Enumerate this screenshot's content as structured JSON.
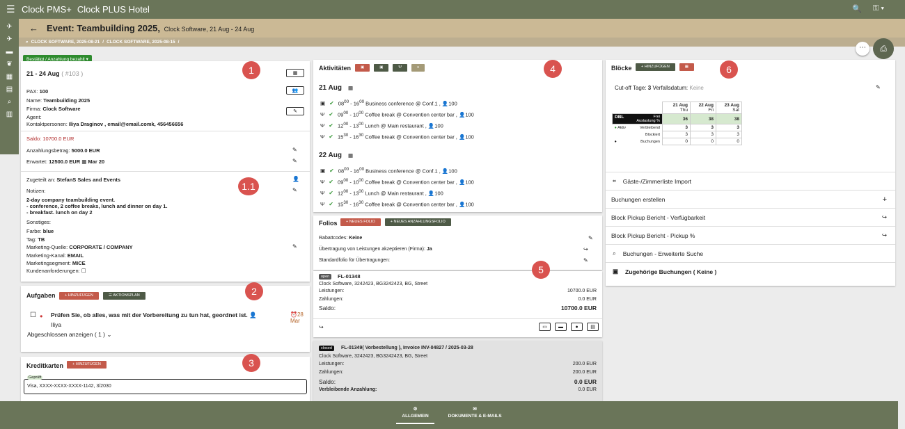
{
  "top": {
    "app": "Clock PMS+",
    "hotel": "Clock PLUS Hotel"
  },
  "header": {
    "title": "Event: Teambuilding 2025,",
    "subtitle": "Clock Software, 21 Aug - 24 Aug",
    "breadcrumb1": "CLOCK SOFTWARE, 2025-08-21",
    "breadcrumb2": "CLOCK SOFTWARE, 2025-08-15"
  },
  "status": "Bestätigt / Anzahlung bezahlt",
  "badges": [
    "1",
    "1.1",
    "2",
    "3",
    "4",
    "5",
    "6"
  ],
  "event": {
    "dates": "21 - 24 Aug",
    "id": "( #103 )",
    "pax_label": "PAX:",
    "pax": "100",
    "name_label": "Name:",
    "name": "Teambuilding 2025",
    "firm_label": "Firma:",
    "firm": "Clock Software",
    "agent_label": "Agent:",
    "contact_label": "Kontaktpersonen:",
    "contact": "Iliya Draginov , email@email.comk, 456456656",
    "saldo": "Saldo: 10700.0 EUR",
    "dep_label": "Anzahlungsbetrag:",
    "dep": "5000.0 EUR",
    "exp_label": "Erwartet:",
    "exp": "12500.0 EUR",
    "exp_date": "Mar 20",
    "assigned_label": "Zugeteilt an:",
    "assigned": "StefanS  Sales and Events",
    "notes_label": "Notizen:",
    "notes1": "2-day company teambuilding event.",
    "notes2": "- conference, 2 coffee breaks, lunch and dinner on day 1.",
    "notes3": "- breakfast. lunch on day 2",
    "other_label": "Sonstiges:",
    "color_label": "Farbe:",
    "color": "blue",
    "tag_label": "Tag:",
    "tag": "TB",
    "mq_label": "Marketing-Quelle:",
    "mq": "CORPORATE / COMPANY",
    "mk_label": "Marketing-Kanal:",
    "mk": "EMAIL",
    "ms_label": "Marketingsegment:",
    "ms": "MICE",
    "req_label": "Kundenanforderungen:"
  },
  "tasks": {
    "title": "Aufgaben",
    "add": "+ HINZUFÜGEN",
    "plan": "AKTIONSPLAN",
    "task": "Prüfen Sie, ob alles, was mit der Vorbereitung zu tun hat, geordnet ist.",
    "user": "Iliya",
    "due_day": "28",
    "due_month": "Mar",
    "completed": "Abgeschlossen anzeigen ( 1 )"
  },
  "cards": {
    "title": "Kreditkarten",
    "add": "+ HINZUFÜGEN",
    "checked": "Geprüft",
    "card": "Visa, XXXX-XXXX-XXXX-1142, 3/2030"
  },
  "activities": {
    "title": "Aktivitäten",
    "days": [
      {
        "date": "21 Aug",
        "items": [
          "Business conference @ Conf.1 ,",
          "Coffee break @ Convention center bar ,",
          "Lunch @ Main restaurant ,",
          "Coffee break @ Convention center bar ,"
        ],
        "times": [
          "08",
          "16",
          "09",
          "10",
          "12",
          "13",
          "15",
          "16"
        ],
        "mins": [
          "00",
          "00",
          "00",
          "00",
          "00",
          "00",
          "30",
          "30"
        ],
        "pax": [
          "100",
          "100",
          "100",
          "100"
        ]
      },
      {
        "date": "22 Aug",
        "items": [
          "Business conference @ Conf.1 ,",
          "Coffee break @ Convention center bar ,",
          "Lunch @ Main restaurant ,",
          "Coffee break @ Convention center bar ,"
        ],
        "times": [
          "08",
          "16",
          "09",
          "10",
          "12",
          "13",
          "15",
          "16"
        ],
        "mins": [
          "00",
          "00",
          "00",
          "00",
          "00",
          "00",
          "30",
          "30"
        ],
        "pax": [
          "100",
          "100",
          "100",
          "100"
        ]
      }
    ]
  },
  "folios": {
    "title": "Folios",
    "new": "+ NEUES FOLIO",
    "newdep": "+ NEUES ANZAHLUNGSFOLIO",
    "disc_label": "Rabattcodes:",
    "disc": "Keine",
    "trans_label": "Übertragung von Leistungen akzeptieren (Firma):",
    "trans": "Ja",
    "std_label": "Standardfolio für Übertragungen:",
    "f1": {
      "state": "open",
      "id": "FL-01348",
      "addr": "Clock Software, 3242423, BG3242423, BG, Street",
      "l_label": "Leistungen:",
      "l": "10700.0 EUR",
      "z_label": "Zahlungen:",
      "z": "0.0 EUR",
      "s_label": "Saldo:",
      "s": "10700.0 EUR"
    },
    "f2": {
      "state": "closed",
      "id": "FL-01349( Vorbestellung ), Invoice INV-04827 / 2025-03-28",
      "addr": "Clock Software, 3242423, BG3242423, BG, Street",
      "l_label": "Leistungen:",
      "l": "200.0 EUR",
      "z_label": "Zahlungen:",
      "z": "200.0 EUR",
      "s_label": "Saldo:",
      "s": "0.0 EUR",
      "r_label": "Verbleibende Anzahlung:",
      "r": "0.0 EUR"
    }
  },
  "blocks": {
    "title": "Blöcke",
    "add": "+ HINZUFÜGEN",
    "cutoff_label": "Cut-off Tage:",
    "cutoff": "3",
    "exp_label": "Verfallsdatum:",
    "exp": "Keine",
    "days": [
      {
        "d": "21 Aug",
        "w": "Thu"
      },
      {
        "d": "22 Aug",
        "w": "Fri"
      },
      {
        "d": "23 Aug",
        "w": "Sat"
      }
    ],
    "room": "DBL",
    "free": "Frei",
    "occ": "Auslastung %",
    "free_vals": [
      "36",
      "38",
      "38"
    ],
    "active": "Aktiv",
    "remaining": "Verbleibend",
    "blocked": "Blockiert",
    "bookings": "Buchungen",
    "rem_vals": [
      "3",
      "3",
      "3"
    ],
    "blk_vals": [
      "3",
      "3",
      "3"
    ],
    "bk_vals": [
      "0",
      "0",
      "0"
    ],
    "links": [
      "Gäste-/Zimmerliste Import",
      "Buchungen erstellen",
      "Block Pickup Bericht - Verfügbarkeit",
      "Block Pickup Bericht - Pickup %",
      "Buchungen - Erweiterte Suche",
      "Zugehörige Buchungen ( Keine )"
    ]
  },
  "bottom": {
    "general": "ALLGEMEIN",
    "docs": "DOKUMENTE & E-MAILS"
  }
}
